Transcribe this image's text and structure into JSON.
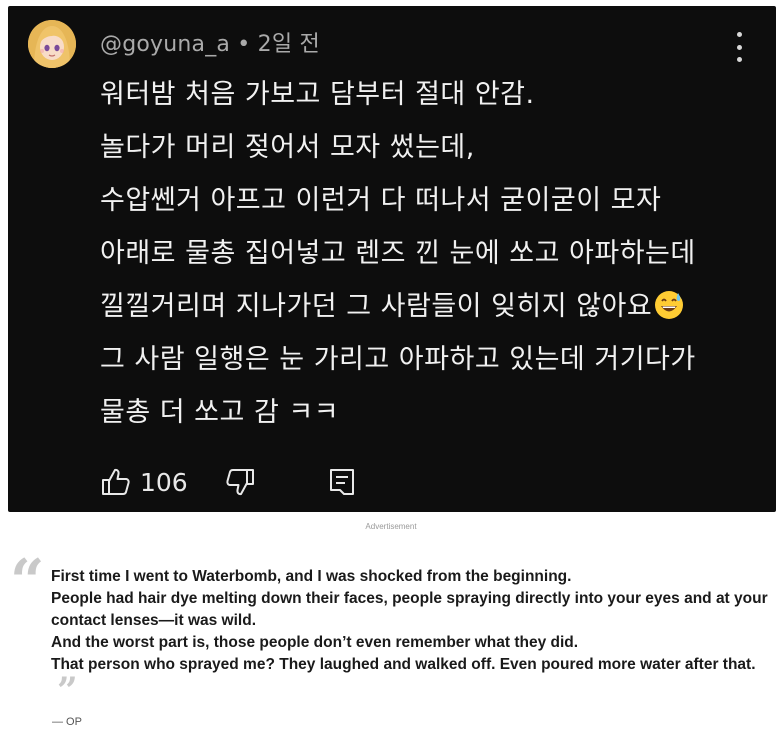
{
  "comment": {
    "username": "@goyuna_a • 2일 전",
    "lines": [
      "워터밤 처음 가보고 담부터 절대 안감.",
      "놀다가 머리 젖어서 모자 썼는데,",
      "수압쎈거 아프고 이런거 다 떠나서 굳이굳이 모자",
      "아래로 물총 집어넣고 렌즈 낀 눈에 쏘고 아파하는데",
      "낄낄거리며 지나가던 그 사람들이 잊히지 않아요",
      "그 사람 일행은 눈 가리고 아파하고 있는데 거기다가",
      "물총 더 쏘고 감 ㅋㅋ"
    ],
    "emoji_icon": "grinning-sweat-emoji",
    "like_count": "106",
    "icons": {
      "like": "thumbs-up-icon",
      "dislike": "thumbs-down-icon",
      "reply": "reply-icon",
      "more": "more-vertical-icon"
    },
    "colors": {
      "background": "#0d0d0d",
      "text": "#f1f1f1",
      "meta": "#aaaaaa"
    }
  },
  "ad_label": "Advertisement",
  "quote": {
    "open_mark": "“",
    "lines": [
      "First time I went to Waterbomb, and I was shocked from the beginning.",
      "People had hair dye melting down their faces, people spraying directly into your eyes and at your contact lenses—it was wild.",
      "And the worst part is, those people don’t even remember what they did.",
      "That person who sprayed me? They laughed and walked off. Even poured more water after that."
    ],
    "close_mark": "”",
    "attribution": "— OP"
  }
}
